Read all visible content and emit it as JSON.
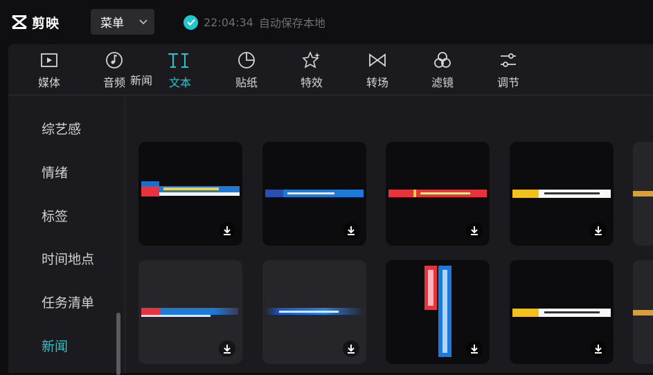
{
  "app": {
    "name": "剪映"
  },
  "menu": {
    "label": "菜单"
  },
  "save_status": {
    "time": "22:04:34",
    "text": "自动保存本地"
  },
  "toolbar": {
    "tabs": [
      {
        "label": "媒体",
        "icon": "media-icon"
      },
      {
        "label": "音频",
        "icon": "audio-icon"
      },
      {
        "label": "文本",
        "icon": "text-icon",
        "active": true
      },
      {
        "label": "贴纸",
        "icon": "sticker-icon"
      },
      {
        "label": "特效",
        "icon": "effects-icon"
      },
      {
        "label": "转场",
        "icon": "transition-icon"
      },
      {
        "label": "滤镜",
        "icon": "filter-icon"
      },
      {
        "label": "调节",
        "icon": "adjust-icon"
      }
    ]
  },
  "sidebar": {
    "items": [
      {
        "label": "综艺感"
      },
      {
        "label": "情绪"
      },
      {
        "label": "标签"
      },
      {
        "label": "时间地点"
      },
      {
        "label": "任务清单"
      },
      {
        "label": "新闻",
        "active": true
      }
    ]
  },
  "content": {
    "section_title": "新闻"
  },
  "colors": {
    "accent": "#21c8cf",
    "bg": "#0f0f12",
    "panel": "#1b1b1f"
  }
}
